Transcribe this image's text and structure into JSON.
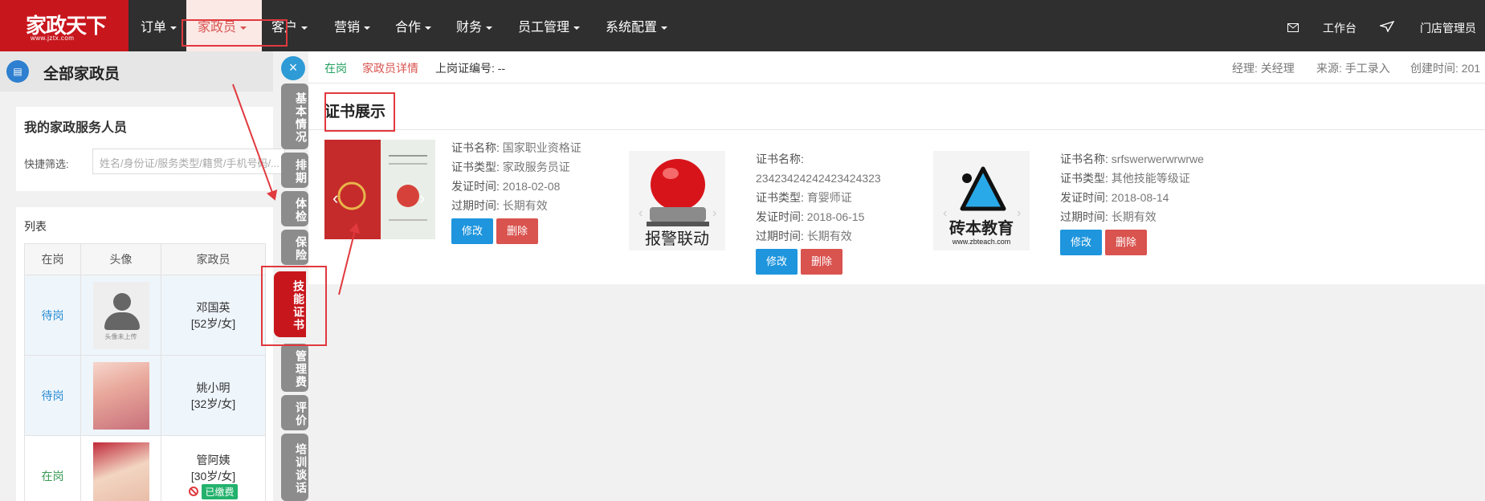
{
  "logo": {
    "brand": "家政天下",
    "site": "www.jztx.com"
  },
  "nav": {
    "items": [
      "订单",
      "家政员",
      "客户",
      "营销",
      "合作",
      "财务",
      "员工管理",
      "系统配置"
    ],
    "active": "家政员"
  },
  "top_right": {
    "workbench": "工作台",
    "user": "门店管理员"
  },
  "left_panel": {
    "title": "全部家政员",
    "section_title": "我的家政服务人员",
    "filter_label": "快捷筛选:",
    "filter_placeholder": "姓名/身份证/服务类型/籍贯/手机号码/...",
    "list_title": "列表",
    "columns": [
      "在岗",
      "头像",
      "家政员"
    ],
    "rows": [
      {
        "status": "待岗",
        "avatar_text": "头像未上传",
        "name": "邓国英",
        "meta": "[52岁/女]"
      },
      {
        "status": "待岗",
        "name": "姚小明",
        "meta": "[32岁/女]"
      },
      {
        "status": "在岗",
        "name": "管阿姨",
        "meta": "[30岁/女]",
        "badge": "已缴费"
      }
    ]
  },
  "vertical_tabs": [
    {
      "label": "基本情况"
    },
    {
      "label": "排期"
    },
    {
      "label": "体检"
    },
    {
      "label": "保险"
    },
    {
      "label": "技能证书",
      "active": true
    },
    {
      "label": "管理费"
    },
    {
      "label": "评价"
    },
    {
      "label": "培训谈话"
    }
  ],
  "info_bar": {
    "status": "在岗",
    "detail_link": "家政员详情",
    "cert_no": "上岗证编号: --",
    "manager": "经理: 关经理",
    "source": "来源: 手工录入",
    "created": "创建时间: 201"
  },
  "section": {
    "title": "证书展示"
  },
  "labels": {
    "name": "证书名称:",
    "type": "证书类型:",
    "issue": "发证时间:",
    "expire": "过期时间:"
  },
  "certificates": [
    {
      "name": "国家职业资格证",
      "type": "家政服务员证",
      "issue": "2018-02-08",
      "expire": "长期有效",
      "image": "certificate-photo"
    },
    {
      "name": "23423424242423424323",
      "type": "育婴师证",
      "issue": "2018-06-15",
      "expire": "长期有效",
      "image": "alarm-light",
      "image_text": "报警联动"
    },
    {
      "name": "srfswerwerwrwrwe",
      "type": "其他技能等级证",
      "issue": "2018-08-14",
      "expire": "长期有效",
      "image": "zbteach-logo",
      "image_text": "砖本教育",
      "image_sub": "www.zbteach.com"
    }
  ],
  "buttons": {
    "edit": "修改",
    "delete": "删除"
  },
  "colors": {
    "brand_red": "#c8161d",
    "nav_bg": "#2f2f2f",
    "accent_blue": "#1e95dd",
    "danger": "#d9534f",
    "success": "#23b26d"
  }
}
